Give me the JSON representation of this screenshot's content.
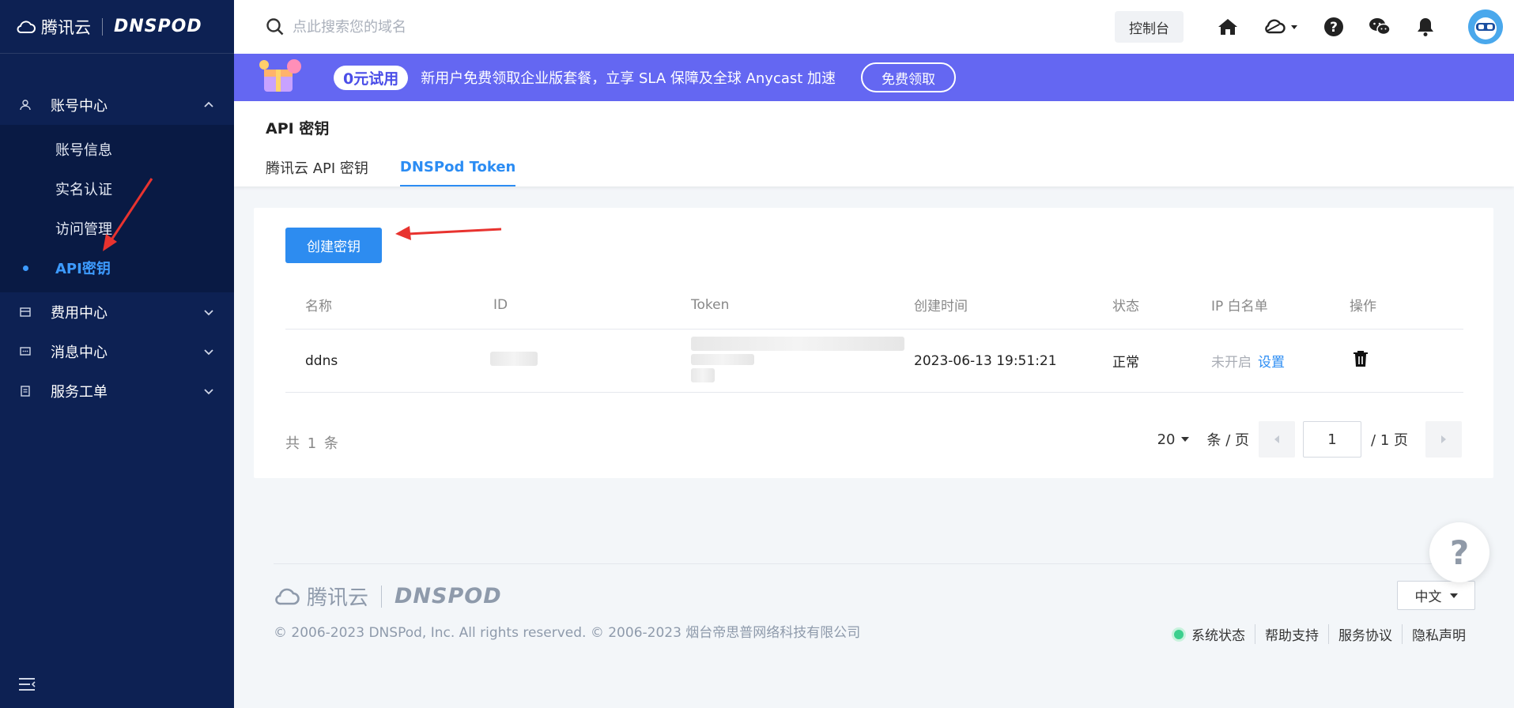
{
  "sidebar": {
    "brand_cn": "腾讯云",
    "brand_dnspod": "DNSPOD",
    "groups": [
      {
        "label": "账号中心",
        "icon": "user-icon",
        "expanded": true
      },
      {
        "label": "费用中心",
        "icon": "wallet-icon",
        "expanded": false
      },
      {
        "label": "消息中心",
        "icon": "message-icon",
        "expanded": false
      },
      {
        "label": "服务工单",
        "icon": "ticket-icon",
        "expanded": false
      }
    ],
    "sub_items": [
      {
        "label": "账号信息"
      },
      {
        "label": "实名认证"
      },
      {
        "label": "访问管理"
      },
      {
        "label": "API密钥",
        "active": true
      }
    ]
  },
  "header": {
    "search_placeholder": "点此搜索您的域名",
    "console_label": "控制台"
  },
  "banner": {
    "badge": "0元试用",
    "text": "新用户免费领取企业版套餐，立享 SLA 保障及全球 Anycast 加速",
    "cta": "免费领取"
  },
  "page": {
    "title": "API 密钥",
    "tabs": [
      {
        "label": "腾讯云 API 密钥"
      },
      {
        "label": "DNSPod Token",
        "active": true
      }
    ],
    "create_button": "创建密钥"
  },
  "table": {
    "columns": [
      "名称",
      "ID",
      "Token",
      "创建时间",
      "状态",
      "IP 白名单",
      "操作"
    ],
    "rows": [
      {
        "name": "ddns",
        "created": "2023-06-13 19:51:21",
        "status": "正常",
        "ip_whitelist": "未开启",
        "ip_action": "设置"
      }
    ]
  },
  "pagination": {
    "total_text": "共 1 条",
    "page_size": "20",
    "page_size_unit": "条 / 页",
    "current_page": "1",
    "total_pages": "/ 1 页"
  },
  "footer": {
    "brand_cn": "腾讯云",
    "brand_dnspod": "DNSPOD",
    "copyright": "© 2006-2023 DNSPod, Inc. All rights reserved. © 2006-2023 烟台帝思普网络科技有限公司",
    "language": "中文",
    "links": [
      "系统状态",
      "帮助支持",
      "服务协议",
      "隐私声明"
    ]
  },
  "help_fab": "?",
  "colors": {
    "sidebar_bg": "#0d2153",
    "accent": "#2d8cf0",
    "banner_bg": "#6467f2",
    "annotation": "#e8332f"
  }
}
